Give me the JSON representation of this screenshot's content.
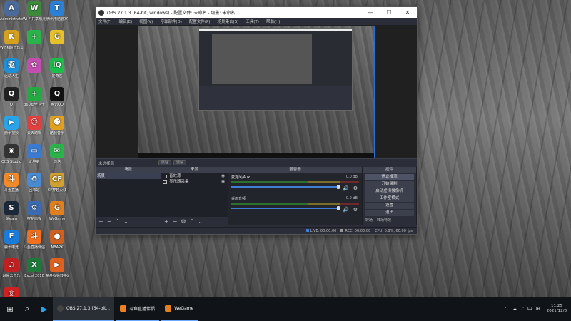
{
  "desktop": {
    "icons": [
      {
        "label": "Administrator",
        "glyph": "A",
        "color": "#4a6a9a"
      },
      {
        "label": "Wi-Fi共享精灵",
        "glyph": "W",
        "color": "#3c8a3c"
      },
      {
        "label": "腾讯电脑管家",
        "glyph": "T",
        "color": "#2b7fd4"
      },
      {
        "label": "WinKey管理工具",
        "glyph": "K",
        "color": "#d4a020"
      },
      {
        "label": "",
        "glyph": "+",
        "color": "#2cb24a"
      },
      {
        "label": "",
        "glyph": "G",
        "color": "#e6c12b"
      },
      {
        "label": "驱动人生",
        "glyph": "驱",
        "color": "#1f8fd8"
      },
      {
        "label": "",
        "glyph": "✿",
        "color": "#c24fb0"
      },
      {
        "label": "爱奇艺",
        "glyph": "iQ",
        "color": "#1bbd4b"
      },
      {
        "label": "Q",
        "glyph": "Q",
        "color": "#222"
      },
      {
        "label": "360安全卫士",
        "glyph": "+",
        "color": "#25a943"
      },
      {
        "label": "腾讯QQ",
        "glyph": "Q",
        "color": "#111"
      },
      {
        "label": "腾讯视频",
        "glyph": "▶",
        "color": "#2aa4e8"
      },
      {
        "label": "天天动听",
        "glyph": "☺",
        "color": "#e04040"
      },
      {
        "label": "酷我音乐",
        "glyph": "☻",
        "color": "#e0a020"
      },
      {
        "label": "OBS Studio",
        "glyph": "◉",
        "color": "#333"
      },
      {
        "label": "此电脑",
        "glyph": "▭",
        "color": "#3a7ad0"
      },
      {
        "label": "微信",
        "glyph": "✉",
        "color": "#2bb24a"
      },
      {
        "label": "斗鱼直播",
        "glyph": "斗",
        "color": "#f08a2a"
      },
      {
        "label": "回收站",
        "glyph": "♻",
        "color": "#4a8ad0"
      },
      {
        "label": "CF穿越火线",
        "glyph": "CF",
        "color": "#d0a030"
      },
      {
        "label": "Steam",
        "glyph": "S",
        "color": "#1b2838"
      },
      {
        "label": "控制面板",
        "glyph": "⚙",
        "color": "#3c6ab0"
      },
      {
        "label": "WeGame",
        "glyph": "G",
        "color": "#e08020"
      },
      {
        "label": "腾讯电竞",
        "glyph": "F",
        "color": "#1a7bd8"
      },
      {
        "label": "斗鱼直播伴侣",
        "glyph": "斗",
        "color": "#f07020"
      },
      {
        "label": "NBA2K",
        "glyph": "●",
        "color": "#d06020"
      },
      {
        "label": "网易云音乐",
        "glyph": "♫",
        "color": "#c02020"
      },
      {
        "label": "Excel 2010",
        "glyph": "X",
        "color": "#1f7a3a"
      },
      {
        "label": "金舟视频转换器",
        "glyph": "▶",
        "color": "#e06020"
      },
      {
        "label": "网易云音乐",
        "glyph": "◎",
        "color": "#d02020"
      }
    ]
  },
  "obs": {
    "title": "OBS 27.1.3 (64-bit, windows) - 配置文件: 未命名 - 场景: 未命名",
    "minimize": "—",
    "maximize": "☐",
    "close": "✕",
    "menu": [
      "文件(F)",
      "编辑(E)",
      "视图(V)",
      "停靠部件(D)",
      "配置文件(P)",
      "场景集合(S)",
      "工具(T)",
      "帮助(H)"
    ],
    "scene_bar": {
      "label": "未选择源",
      "btn1": "属性",
      "btn2": "滤镜"
    },
    "docks": {
      "scenes": {
        "title": "场景",
        "items": [
          "场景"
        ]
      },
      "sources": {
        "title": "来源",
        "items": [
          {
            "label": "音效源",
            "eye": "◉",
            "lock": "🔒"
          },
          {
            "label": "显示器采集",
            "eye": "◉",
            "lock": "🔒"
          }
        ]
      },
      "mixer": {
        "title": "混音器",
        "channels": [
          {
            "name": "麦克风/Aux",
            "db": "0.0 dB",
            "level": 0.9
          },
          {
            "name": "桌面音频",
            "db": "0.0 dB",
            "level": 0.9
          }
        ]
      },
      "controls": {
        "title": "控件",
        "buttons": [
          "停止推流",
          "开始录制",
          "启动虚拟摄像机",
          "工作室模式",
          "设置",
          "退出"
        ]
      },
      "transitions_tab": "转场",
      "controls_tab": "转场特效"
    },
    "status": {
      "live_label": "LIVE:",
      "live_time": "00:00:00",
      "rec_label": "REC:",
      "rec_time": "00:00:00",
      "cpu": "CPU: 0.9%, 60.00 fps"
    },
    "footer_glyphs": {
      "add": "+",
      "remove": "−",
      "settings": "⚙",
      "up": "⌃",
      "down": "⌄"
    }
  },
  "taskbar": {
    "start_icon": "⊞",
    "search_icon": "⌕",
    "apps": [
      {
        "label": "OBS 27.1.3 (64-bit...",
        "color": "#444"
      },
      {
        "label": "斗鱼直播伴侣",
        "color": "#f08020"
      },
      {
        "label": "WeGame",
        "color": "#e08020"
      }
    ],
    "tray": [
      "⌃",
      "☁",
      "♪",
      "中",
      "⊞"
    ],
    "time": "11:25",
    "date": "2021/12/8"
  }
}
